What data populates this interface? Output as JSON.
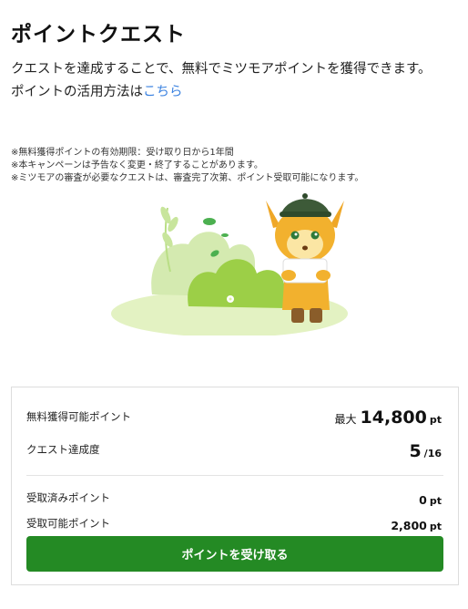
{
  "page": {
    "title": "ポイントクエスト"
  },
  "intro": {
    "text": "クエストを達成することで、無料でミツモアポイントを獲得できます。",
    "how_to_prefix": "ポイントの活用方法は",
    "how_to_link": "こちら"
  },
  "notes": [
    "※無料獲得ポイントの有効期限：受け取り日から1年間",
    "※本キャンペーンは予告なく変更・終了することがあります。",
    "※ミツモアの審査が必要なクエストは、審査完了次第、ポイント受取可能になります。"
  ],
  "summary": {
    "free_points_label": "無料獲得可能ポイント",
    "free_points_prefix": "最大",
    "free_points_value": "14,800",
    "free_points_unit": "pt",
    "quest_label": "クエスト達成度",
    "quest_done": "5",
    "quest_total": "/16",
    "received_label": "受取済みポイント",
    "received_value": "0",
    "received_unit": "pt",
    "receivable_label": "受取可能ポイント",
    "receivable_value": "2,800",
    "receivable_unit": "pt",
    "claim_button": "ポイントを受け取る"
  },
  "colors": {
    "accent_green": "#248a24",
    "link_blue": "#3b82e0"
  },
  "icons": {
    "mascot": "deer-mascot-illustration"
  }
}
